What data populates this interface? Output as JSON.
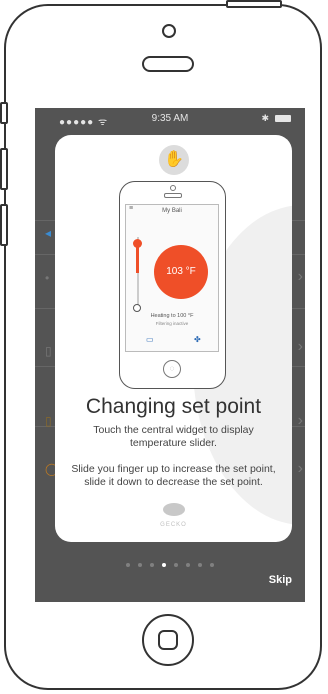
{
  "status_bar": {
    "carrier": "●●●●● ᯤ",
    "time": "9:35 AM",
    "bluetooth": "✱"
  },
  "background_icons": [
    "◂",
    "•",
    "▯",
    "▯",
    "◯"
  ],
  "onboarding": {
    "mini_phone": {
      "title": "My Bali",
      "temperature": "103 °F",
      "heating_line": "Heating to 100 °F",
      "status_line": "Filtering inactive"
    },
    "title": "Changing set point",
    "description_1": "Touch the central widget to display temperature slider.",
    "description_2": "Slide you finger up to increase the set point, slide it down to decrease the set point.",
    "brand": "GECKO",
    "page_count": 8,
    "active_page": 3,
    "skip_label": "Skip"
  },
  "colors": {
    "accent": "#ef4f28",
    "screen_dim": "#545454",
    "card": "#ffffff"
  },
  "icons": {
    "top_logo": "hand-icon",
    "home": "home-button-icon"
  }
}
